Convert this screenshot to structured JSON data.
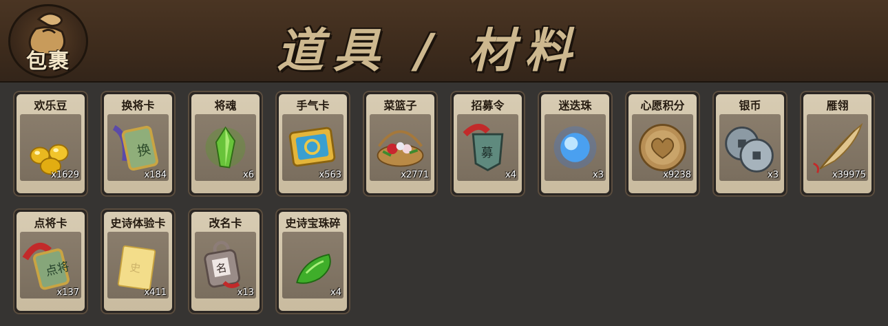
{
  "header": {
    "bag_label": "包裹",
    "title": "道具 / 材料"
  },
  "items": [
    {
      "name": "欢乐豆",
      "count": "x1629",
      "icon": "gold-beans-icon"
    },
    {
      "name": "换将卡",
      "count": "x184",
      "icon": "swap-general-card-icon"
    },
    {
      "name": "将魂",
      "count": "x6",
      "icon": "green-crystal-icon"
    },
    {
      "name": "手气卡",
      "count": "x563",
      "icon": "luck-card-icon"
    },
    {
      "name": "菜篮子",
      "count": "x2771",
      "icon": "flower-basket-icon"
    },
    {
      "name": "招募令",
      "count": "x4",
      "icon": "recruit-token-icon"
    },
    {
      "name": "迷迭珠",
      "count": "x3",
      "icon": "blue-orb-icon"
    },
    {
      "name": "心愿积分",
      "count": "x9238",
      "icon": "heart-coin-icon"
    },
    {
      "name": "银币",
      "count": "x3",
      "icon": "silver-coins-icon"
    },
    {
      "name": "雁翎",
      "count": "x39975",
      "icon": "feather-quill-icon"
    },
    {
      "name": "点将卡",
      "count": "x137",
      "icon": "select-general-card-icon"
    },
    {
      "name": "史诗体验卡",
      "count": "x411",
      "icon": "gold-card-icon"
    },
    {
      "name": "改名卡",
      "count": "x13",
      "icon": "rename-card-icon"
    },
    {
      "name": "史诗宝珠碎",
      "count": "x4",
      "icon": "green-shard-icon"
    }
  ]
}
